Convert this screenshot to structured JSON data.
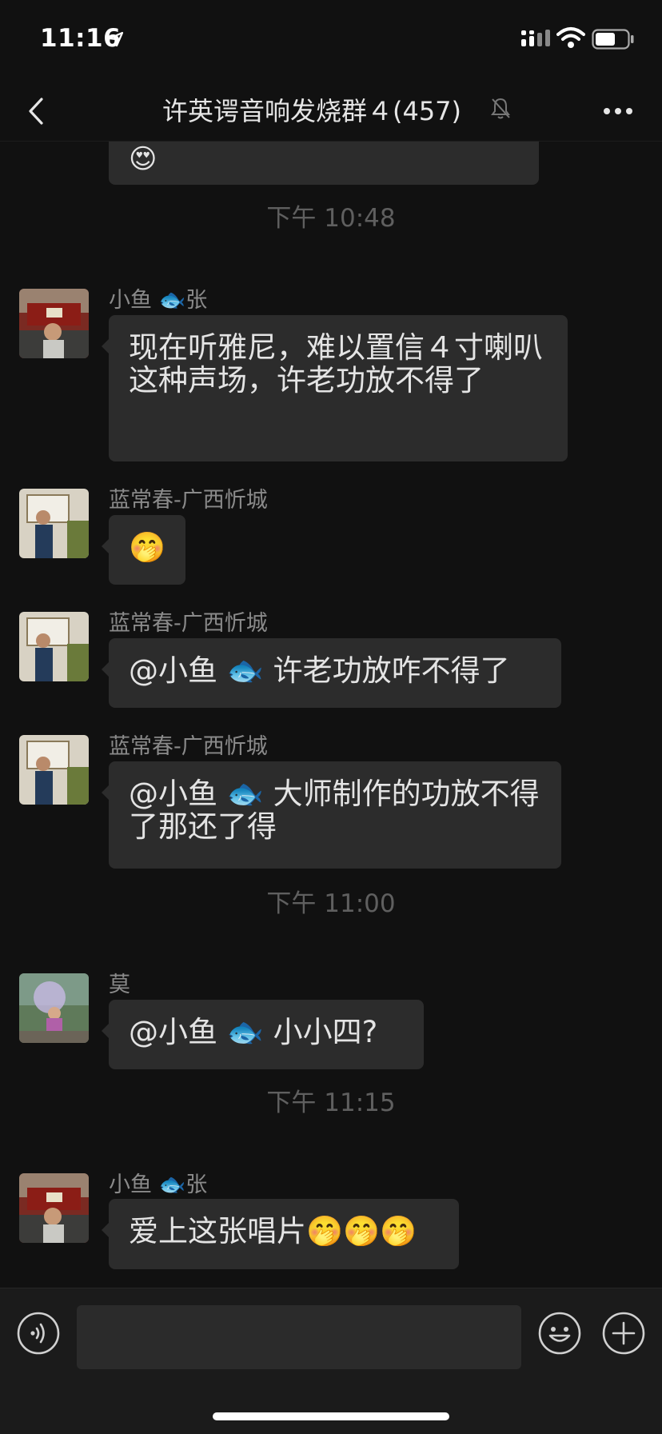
{
  "status_bar": {
    "time": "11:16",
    "battery_level": 0.62
  },
  "nav": {
    "title": "许英谔音响发烧群４(457)",
    "muted": true
  },
  "chat": {
    "prev_emoji": "😍",
    "messages": [
      {
        "type": "time",
        "text": "下午 10:48"
      },
      {
        "type": "msg",
        "sender": "小鱼 🐟张",
        "text": "现在听雅尼，难以置信４寸喇叭这种声场，许老功放不得了"
      },
      {
        "type": "msg",
        "sender": "蓝常春-广西忻城",
        "text": "🤭"
      },
      {
        "type": "msg",
        "sender": "蓝常春-广西忻城",
        "text": "@小鱼 🐟 许老功放咋不得了"
      },
      {
        "type": "msg",
        "sender": "蓝常春-广西忻城",
        "text": "@小鱼 🐟 大师制作的功放不得了那还了得"
      },
      {
        "type": "time",
        "text": "下午 11:00"
      },
      {
        "type": "msg",
        "sender": "莫",
        "text": "@小鱼 🐟 小小四?"
      },
      {
        "type": "time",
        "text": "下午 11:15"
      },
      {
        "type": "msg",
        "sender": "小鱼 🐟张",
        "text": "爱上这张唱片🤭🤭🤭"
      }
    ]
  },
  "input_bar": {
    "value": "",
    "placeholder": ""
  },
  "colors": {
    "background": "#111111",
    "bubble": "#2c2c2c",
    "text": "#e4e4e4",
    "time": "#5f5f5f",
    "sender": "#8a8a8a"
  },
  "icons": [
    "location-arrow-icon",
    "signal-icon",
    "wifi-icon",
    "battery-icon",
    "back-chevron-icon",
    "mute-bell-icon",
    "more-dots-icon",
    "voice-icon",
    "emoji-face-icon",
    "plus-icon"
  ]
}
